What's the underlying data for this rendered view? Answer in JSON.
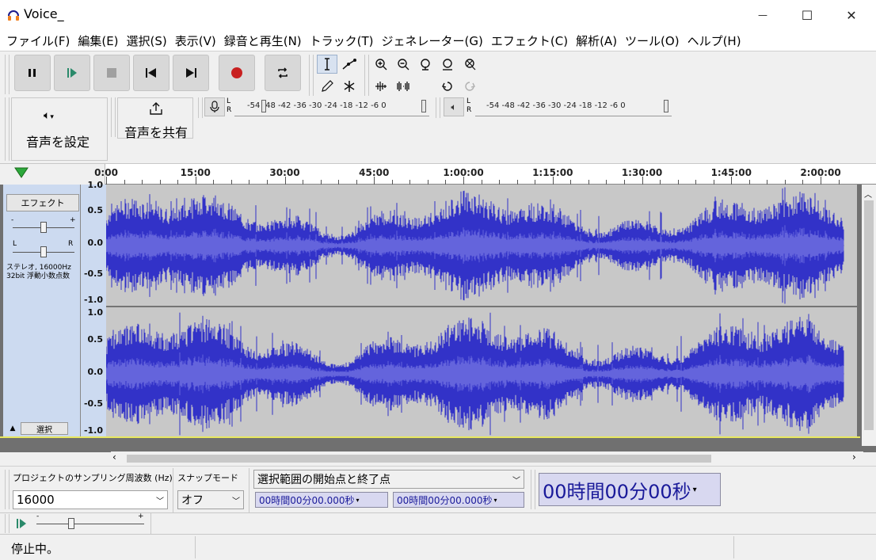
{
  "window": {
    "title": "Voice_",
    "minimize_glyph": "—",
    "maximize_glyph": "☐",
    "close_glyph": "✕"
  },
  "menu": [
    "ファイル(F)",
    "編集(E)",
    "選択(S)",
    "表示(V)",
    "録音と再生(N)",
    "トラック(T)",
    "ジェネレーター(G)",
    "エフェクト(C)",
    "解析(A)",
    "ツール(O)",
    "ヘルプ(H)"
  ],
  "audio_setup": {
    "label": "音声を設定",
    "icon": "speaker-icon"
  },
  "share_audio": {
    "label": "音声を共有",
    "icon": "share-icon"
  },
  "meters": {
    "channel_l": "L",
    "channel_r": "R",
    "scale": "-54 -48 -42 -36 -30 -24 -18 -12 -6 0"
  },
  "timeline": {
    "labels": [
      "0:00",
      "15:00",
      "30:00",
      "45:00",
      "1:00:00",
      "1:15:00",
      "1:30:00",
      "1:45:00",
      "2:00:00"
    ]
  },
  "track": {
    "effects_button": "エフェクト",
    "gain_min": "-",
    "gain_max": "+",
    "pan_left": "L",
    "pan_right": "R",
    "info_line1": "ステレオ, 16000Hz",
    "info_line2": "32bit 浮動小数点数",
    "select_button": "選択",
    "axis": [
      "1.0",
      "0.5",
      "0.0",
      "-0.5",
      "-1.0"
    ],
    "waveform_color": "#3232c8",
    "rms_color": "#6464dc"
  },
  "bottom": {
    "rate_label": "プロジェクトのサンプリング周波数 (Hz)",
    "rate_value": "16000",
    "snap_label": "スナップモード",
    "snap_value": "オフ",
    "selection_mode": "選択範囲の開始点と終了点",
    "sel_start": "00時間00分00.000秒",
    "sel_end": "00時間00分00.000秒",
    "big_time": "00時間00分00秒",
    "play_speed_min": "-",
    "play_speed_max": "+"
  },
  "status": {
    "text": "停止中。"
  }
}
